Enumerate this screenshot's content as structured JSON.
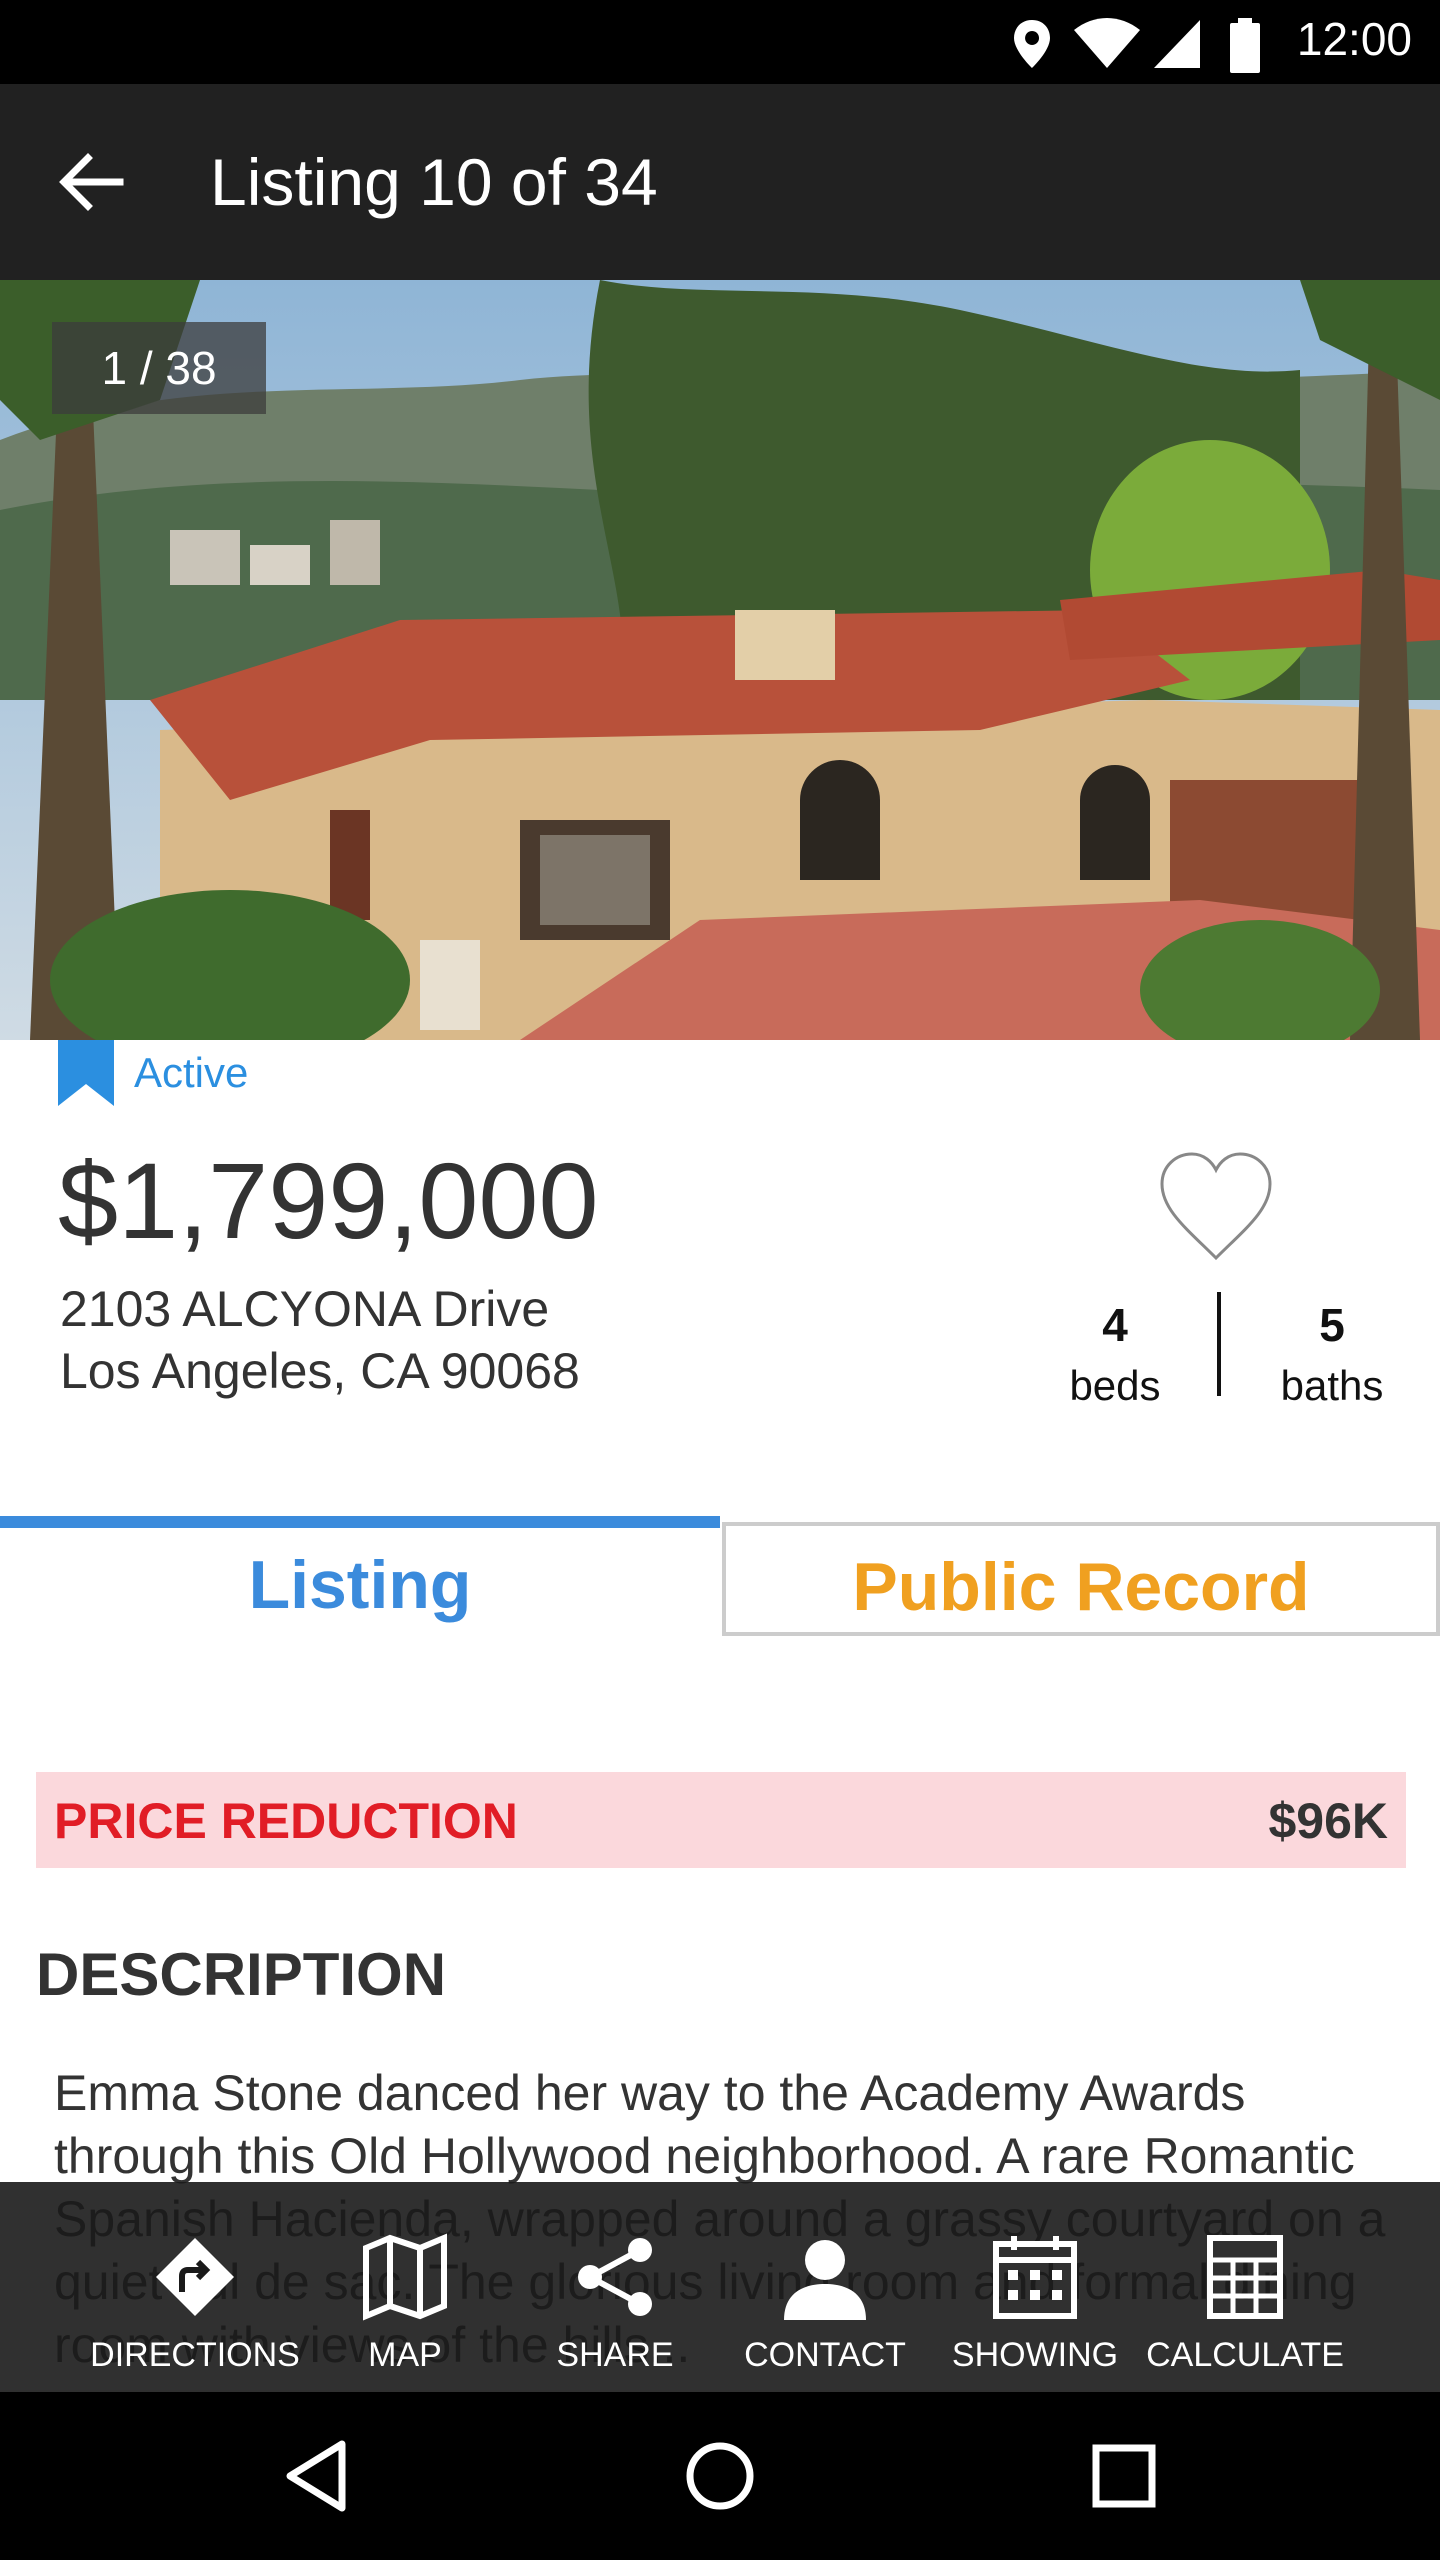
{
  "status_bar": {
    "time": "12:00",
    "icons": [
      "location-icon",
      "wifi-icon",
      "signal-icon",
      "battery-icon"
    ]
  },
  "app_bar": {
    "title": "Listing 10 of 34",
    "back_icon": "arrow-left-icon"
  },
  "photo": {
    "counter": "1 / 38"
  },
  "listing": {
    "status": "Active",
    "price": "$1,799,000",
    "address_line1": "2103 ALCYONA Drive",
    "address_line2": "Los Angeles, CA 90068",
    "beds_value": "4",
    "beds_label": "beds",
    "baths_value": "5",
    "baths_label": "baths"
  },
  "tabs": [
    {
      "label": "Listing",
      "selected": true
    },
    {
      "label": "Public Record",
      "selected": false
    }
  ],
  "price_reduction": {
    "label": "PRICE REDUCTION",
    "amount": "$96K"
  },
  "description": {
    "heading": "DESCRIPTION",
    "text": "Emma Stone danced her way to the Academy Awards through this Old Hollywood neighborhood. A rare Romantic Spanish Hacienda, wrapped around a grassy courtyard on a quiet cul de sac. The glorious living room and formal dining room with views of the hills..."
  },
  "actions": [
    {
      "label": "DIRECTIONS",
      "icon": "directions-icon"
    },
    {
      "label": "MAP",
      "icon": "map-icon"
    },
    {
      "label": "SHARE",
      "icon": "share-icon"
    },
    {
      "label": "CONTACT",
      "icon": "person-icon"
    },
    {
      "label": "SHOWING",
      "icon": "calendar-icon"
    },
    {
      "label": "CALCULATE",
      "icon": "calculator-icon"
    }
  ],
  "colors": {
    "accent_blue": "#3b8bdc",
    "public_record_orange": "#f0a020",
    "reduction_red": "#e11d26",
    "reduction_bg": "#fbd8dc",
    "app_bar": "#212121"
  }
}
